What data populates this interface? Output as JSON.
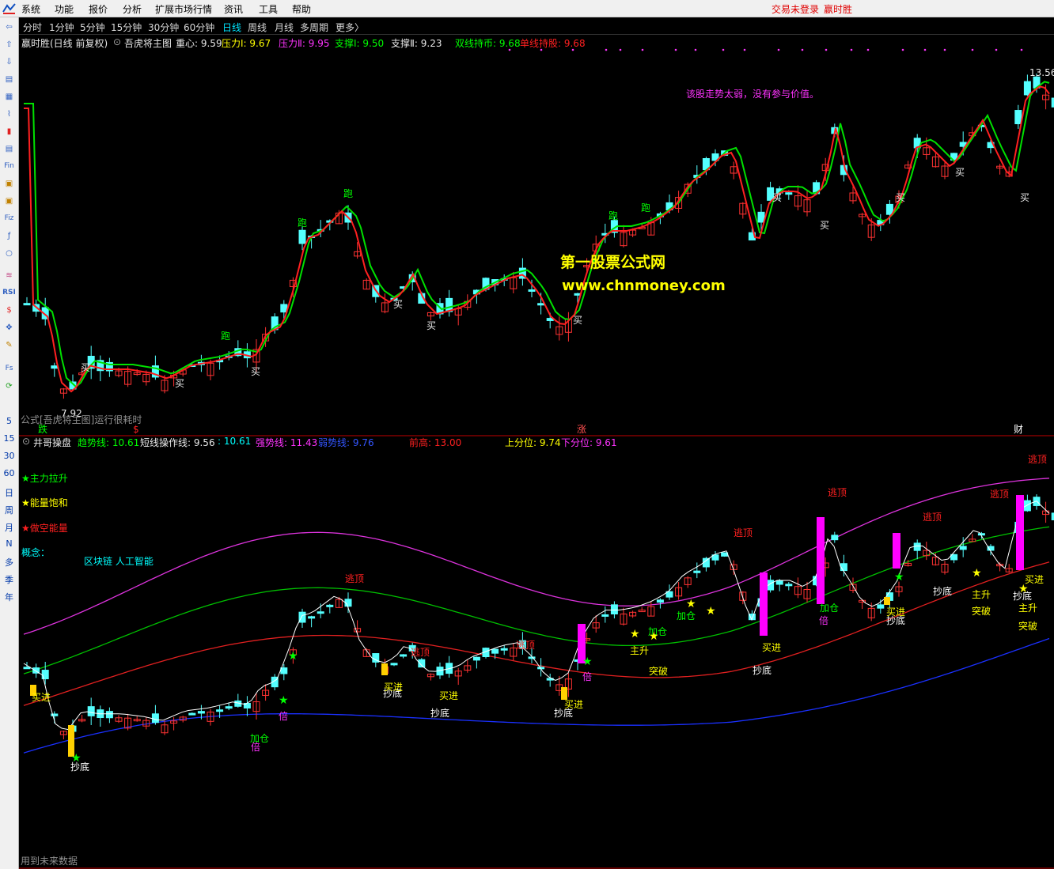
{
  "menu": {
    "items": [
      "系统",
      "功能",
      "报价",
      "分析",
      "扩展市场行情",
      "资讯",
      "工具",
      "帮助"
    ],
    "status": "交易未登录",
    "stock_name": "嬴时胜"
  },
  "periods": [
    "分时",
    "1分钟",
    "5分钟",
    "15分钟",
    "30分钟",
    "60分钟",
    "日线",
    "周线",
    "月线",
    "多周期",
    "更多〉"
  ],
  "active_period": "日线",
  "toolbar_text": [
    "5",
    "15",
    "30",
    "60",
    "日",
    "周",
    "月",
    "N",
    "多",
    "季",
    "年"
  ],
  "upper": {
    "title": "嬴时胜(日线 前复权)",
    "indicator": "吾虎将主图",
    "values": [
      {
        "label": "重心: 9.59",
        "color": "#e8e8e8"
      },
      {
        "label": "压力Ⅰ: 9.67",
        "color": "#ffff00"
      },
      {
        "label": "压力Ⅱ: 9.95",
        "color": "#ff33ff"
      },
      {
        "label": "支撑Ⅰ: 9.50",
        "color": "#00ff00"
      },
      {
        "label": "支撑Ⅱ: 9.23",
        "color": "#e8e8e8"
      },
      {
        "label": "双线持币: 9.68",
        "color": "#00ff00"
      },
      {
        "label": "单线持股: 9.68",
        "color": "#ff2020"
      }
    ],
    "warning": "该股走势太弱，没有参与价值。",
    "watermark_site": "第一股票公式网",
    "watermark_url": "www.chnmoney.com",
    "high_label": "13.56",
    "low_label": "7.92",
    "note": "公式[吾虎将主图]运行很耗时",
    "signals": [
      "跑",
      "买",
      "跌",
      "$",
      "涨",
      "财"
    ]
  },
  "lower": {
    "indicator": "井哥操盘",
    "values": [
      {
        "label": "趋势线: 10.61",
        "color": "#00ff00"
      },
      {
        "label": "短线操作线: 9.56",
        "color": "#e8e8e8"
      },
      {
        "label": ": 10.61",
        "color": "#00ffff"
      },
      {
        "label": "强势线: 11.43",
        "color": "#ff33ff"
      },
      {
        "label": "弱势线: 9.76",
        "color": "#3355ff"
      },
      {
        "label": "前高: 13.00",
        "color": "#ff2020"
      },
      {
        "label": "上分位: 9.74",
        "color": "#ffff00"
      },
      {
        "label": "下分位: 9.61",
        "color": "#ff33ff"
      }
    ],
    "legend": [
      {
        "label": "★主力拉升",
        "color": "#00ff00"
      },
      {
        "label": "★能量饱和",
        "color": "#ffff00"
      },
      {
        "label": "★做空能量",
        "color": "#ff2020"
      }
    ],
    "concept_label": "概念：",
    "concepts": "区块链 人工智能",
    "footer": "用到未来数据",
    "signals": [
      "逃顶",
      "抄底",
      "买进",
      "加仓",
      "倍",
      "主升",
      "突破"
    ]
  },
  "colors": {
    "up": "#ff3232",
    "down": "#54ffff",
    "ma_fast": "#ff2020",
    "ma_slow": "#00e000"
  }
}
